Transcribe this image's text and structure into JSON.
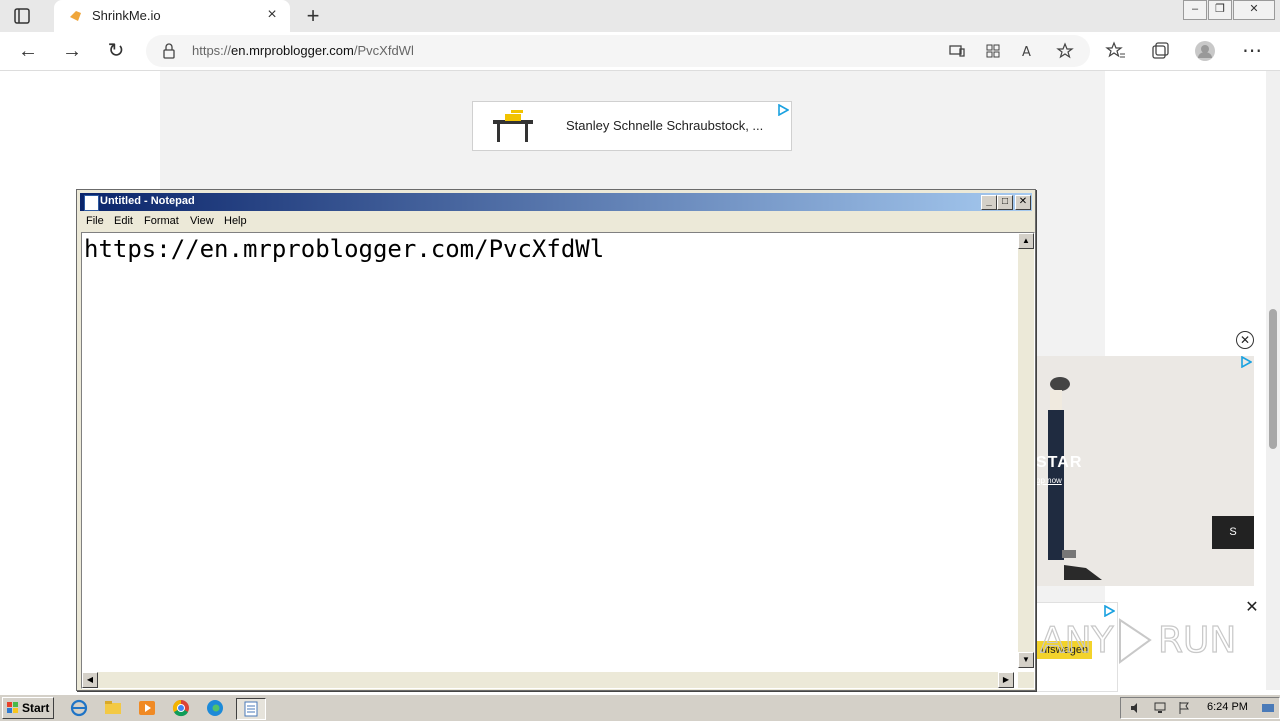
{
  "browser": {
    "tab": {
      "title": "ShrinkMe.io"
    },
    "address": {
      "url_prefix": "https://",
      "url_host": "en.mrproblogger.com",
      "url_path": "/PvcXfdWl"
    }
  },
  "page": {
    "ad_top": {
      "text": "Stanley Schnelle Schraubstock, ..."
    },
    "ad_right": {
      "brand_text": "STAR",
      "sub_text": "op now",
      "button_label": "S"
    },
    "ad_bottom": {
      "text": "ufswagen"
    }
  },
  "notepad": {
    "title": "Untitled - Notepad",
    "menu": [
      "File",
      "Edit",
      "Format",
      "View",
      "Help"
    ],
    "content": "https://en.mrproblogger.com/PvcXfdWl"
  },
  "taskbar": {
    "start_label": "Start",
    "time": "6:24 PM"
  },
  "colors": {
    "title_gradient_start": "#0a246a",
    "title_gradient_end": "#a6caf0",
    "taskbar": "#d4d0c8"
  }
}
